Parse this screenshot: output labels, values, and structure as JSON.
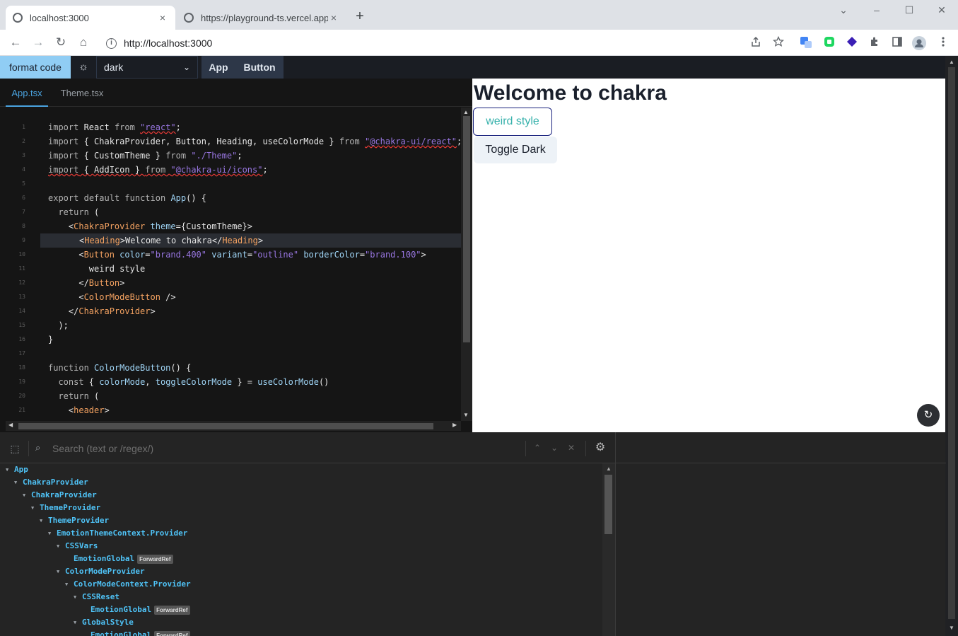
{
  "browser": {
    "tabs": [
      {
        "title": "localhost:3000",
        "close": "×"
      },
      {
        "title": "https://playground-ts.vercel.app",
        "close": "×"
      }
    ],
    "new_tab": "+",
    "controls": {
      "menu": "⌄",
      "minimize": "–",
      "maximize": "☐",
      "close": "✕"
    },
    "nav": {
      "back": "←",
      "forward": "→",
      "reload": "↻",
      "home": "⌂"
    },
    "url": "http://localhost:3000",
    "info_glyph": "i"
  },
  "app_toolbar": {
    "format_label": "format code",
    "theme_glyph": "☼",
    "theme_value": "dark",
    "chevron": "⌄",
    "file_tabs": [
      "App",
      "Button"
    ]
  },
  "editor": {
    "tabs": [
      "App.tsx",
      "Theme.tsx"
    ],
    "highlight_line": 9,
    "lines": [
      {
        "n": "1",
        "segs": [
          [
            "import",
            "#b3b3b3"
          ],
          [
            " React ",
            "#e6e6e6"
          ],
          [
            "from",
            "#b3b3b3"
          ],
          [
            " ",
            "#e6e6e6"
          ],
          [
            "\"react\"",
            "#9876e0",
            "squig"
          ],
          [
            ";",
            "#e6e6e6"
          ]
        ]
      },
      {
        "n": "2",
        "segs": [
          [
            "import",
            "#b3b3b3"
          ],
          [
            " { ChakraProvider, Button, Heading, useColorMode } ",
            "#e6e6e6"
          ],
          [
            "from",
            "#b3b3b3"
          ],
          [
            " ",
            "#e6e6e6"
          ],
          [
            "\"@chakra-ui/react\"",
            "#9876e0",
            "squig"
          ],
          [
            ";",
            "#e6e6e6"
          ]
        ]
      },
      {
        "n": "3",
        "segs": [
          [
            "import",
            "#b3b3b3"
          ],
          [
            " { CustomTheme } ",
            "#e6e6e6"
          ],
          [
            "from",
            "#b3b3b3"
          ],
          [
            " ",
            "#e6e6e6"
          ],
          [
            "\"./Theme\"",
            "#9876e0"
          ],
          [
            ";",
            "#e6e6e6"
          ]
        ]
      },
      {
        "n": "4",
        "segs": [
          [
            "import",
            "#b3b3b3",
            "squig"
          ],
          [
            " { AddIcon } ",
            "#e6e6e6",
            "squig"
          ],
          [
            "from",
            "#b3b3b3",
            "squig"
          ],
          [
            " ",
            "#e6e6e6",
            "squig"
          ],
          [
            "\"@chakra-ui/icons\"",
            "#9876e0",
            "squig"
          ],
          [
            ";",
            "#e6e6e6"
          ]
        ]
      },
      {
        "n": "5",
        "segs": []
      },
      {
        "n": "6",
        "segs": [
          [
            "export",
            "#b3b3b3"
          ],
          [
            " ",
            "#e6e6e6"
          ],
          [
            "default",
            "#b3b3b3"
          ],
          [
            " ",
            "#e6e6e6"
          ],
          [
            "function",
            "#b3b3b3"
          ],
          [
            " ",
            "#e6e6e6"
          ],
          [
            "App",
            "#9fd4f5"
          ],
          [
            "() {",
            "#e6e6e6"
          ]
        ]
      },
      {
        "n": "7",
        "segs": [
          [
            "  ",
            "#e6e6e6"
          ],
          [
            "return",
            "#b3b3b3"
          ],
          [
            " (",
            "#e6e6e6"
          ]
        ]
      },
      {
        "n": "8",
        "segs": [
          [
            "    <",
            "#e6e6e6"
          ],
          [
            "ChakraProvider",
            "#f4a261"
          ],
          [
            " ",
            "#e6e6e6"
          ],
          [
            "theme",
            "#9fd4f5"
          ],
          [
            "={CustomTheme}>",
            "#e6e6e6"
          ]
        ]
      },
      {
        "n": "9",
        "segs": [
          [
            "<",
            "#e6e6e6"
          ],
          [
            "Heading",
            "#f4a261"
          ],
          [
            ">Welcome to chakra</",
            "#e6e6e6"
          ],
          [
            "Heading",
            "#f4a261"
          ],
          [
            ">",
            "#e6e6e6"
          ]
        ]
      },
      {
        "n": "10",
        "segs": [
          [
            "      <",
            "#e6e6e6"
          ],
          [
            "Button",
            "#f4a261"
          ],
          [
            " ",
            "#e6e6e6"
          ],
          [
            "color",
            "#9fd4f5"
          ],
          [
            "=",
            "#e6e6e6"
          ],
          [
            "\"brand.400\"",
            "#9876e0"
          ],
          [
            " ",
            "#e6e6e6"
          ],
          [
            "variant",
            "#9fd4f5"
          ],
          [
            "=",
            "#e6e6e6"
          ],
          [
            "\"outline\"",
            "#9876e0"
          ],
          [
            " ",
            "#e6e6e6"
          ],
          [
            "borderColor",
            "#9fd4f5"
          ],
          [
            "=",
            "#e6e6e6"
          ],
          [
            "\"brand.100\"",
            "#9876e0"
          ],
          [
            ">",
            "#e6e6e6"
          ]
        ]
      },
      {
        "n": "11",
        "segs": [
          [
            "        weird style",
            "#e6e6e6"
          ]
        ]
      },
      {
        "n": "12",
        "segs": [
          [
            "      </",
            "#e6e6e6"
          ],
          [
            "Button",
            "#f4a261"
          ],
          [
            ">",
            "#e6e6e6"
          ]
        ]
      },
      {
        "n": "13",
        "segs": [
          [
            "      <",
            "#e6e6e6"
          ],
          [
            "ColorModeButton",
            "#f4a261"
          ],
          [
            " />",
            "#e6e6e6"
          ]
        ]
      },
      {
        "n": "14",
        "segs": [
          [
            "    </",
            "#e6e6e6"
          ],
          [
            "ChakraProvider",
            "#f4a261"
          ],
          [
            ">",
            "#e6e6e6"
          ]
        ]
      },
      {
        "n": "15",
        "segs": [
          [
            "  );",
            "#e6e6e6"
          ]
        ]
      },
      {
        "n": "16",
        "segs": [
          [
            "}",
            "#e6e6e6"
          ]
        ]
      },
      {
        "n": "17",
        "segs": []
      },
      {
        "n": "18",
        "segs": [
          [
            "function",
            "#b3b3b3"
          ],
          [
            " ",
            "#e6e6e6"
          ],
          [
            "ColorModeButton",
            "#9fd4f5"
          ],
          [
            "() {",
            "#e6e6e6"
          ]
        ]
      },
      {
        "n": "19",
        "segs": [
          [
            "  ",
            "#e6e6e6"
          ],
          [
            "const",
            "#b3b3b3"
          ],
          [
            " { ",
            "#e6e6e6"
          ],
          [
            "colorMode",
            "#9fd4f5"
          ],
          [
            ", ",
            "#e6e6e6"
          ],
          [
            "toggleColorMode",
            "#9fd4f5"
          ],
          [
            " } = ",
            "#e6e6e6"
          ],
          [
            "useColorMode",
            "#9fd4f5"
          ],
          [
            "()",
            "#e6e6e6"
          ]
        ]
      },
      {
        "n": "20",
        "segs": [
          [
            "  ",
            "#e6e6e6"
          ],
          [
            "return",
            "#b3b3b3"
          ],
          [
            " (",
            "#e6e6e6"
          ]
        ]
      },
      {
        "n": "21",
        "segs": [
          [
            "    <",
            "#e6e6e6"
          ],
          [
            "header",
            "#f4a261"
          ],
          [
            ">",
            "#e6e6e6"
          ]
        ]
      }
    ]
  },
  "preview": {
    "heading": "Welcome to chakra",
    "button1": "weird style",
    "button2": "Toggle Dark",
    "refresh_glyph": "↻"
  },
  "devtools": {
    "search_placeholder": "Search (text or /regex/)",
    "glyphs": {
      "picker": "⬚",
      "search": "⌕",
      "up": "⌃",
      "down": "⌄",
      "clear": "✕",
      "gear": "⚙"
    },
    "tree": [
      {
        "name": "App",
        "depth": 0,
        "expanded": true
      },
      {
        "name": "ChakraProvider",
        "depth": 1,
        "expanded": true
      },
      {
        "name": "ChakraProvider",
        "depth": 2,
        "expanded": true
      },
      {
        "name": "ThemeProvider",
        "depth": 3,
        "expanded": true
      },
      {
        "name": "ThemeProvider",
        "depth": 4,
        "expanded": true
      },
      {
        "name": "EmotionThemeContext.Provider",
        "depth": 5,
        "expanded": true
      },
      {
        "name": "CSSVars",
        "depth": 6,
        "expanded": true
      },
      {
        "name": "EmotionGlobal",
        "depth": 7,
        "expanded": false,
        "badge": "ForwardRef"
      },
      {
        "name": "ColorModeProvider",
        "depth": 6,
        "expanded": true
      },
      {
        "name": "ColorModeContext.Provider",
        "depth": 7,
        "expanded": true
      },
      {
        "name": "CSSReset",
        "depth": 8,
        "expanded": true
      },
      {
        "name": "EmotionGlobal",
        "depth": 9,
        "expanded": false,
        "badge": "ForwardRef"
      },
      {
        "name": "GlobalStyle",
        "depth": 8,
        "expanded": true
      },
      {
        "name": "EmotionGlobal",
        "depth": 9,
        "expanded": false,
        "badge": "ForwardRef"
      }
    ]
  },
  "colors": {
    "accent_blue": "#4aa3df",
    "format_button": "#90cdf4",
    "tree_text": "#4fc3f7",
    "teal": "#38b2ac"
  }
}
